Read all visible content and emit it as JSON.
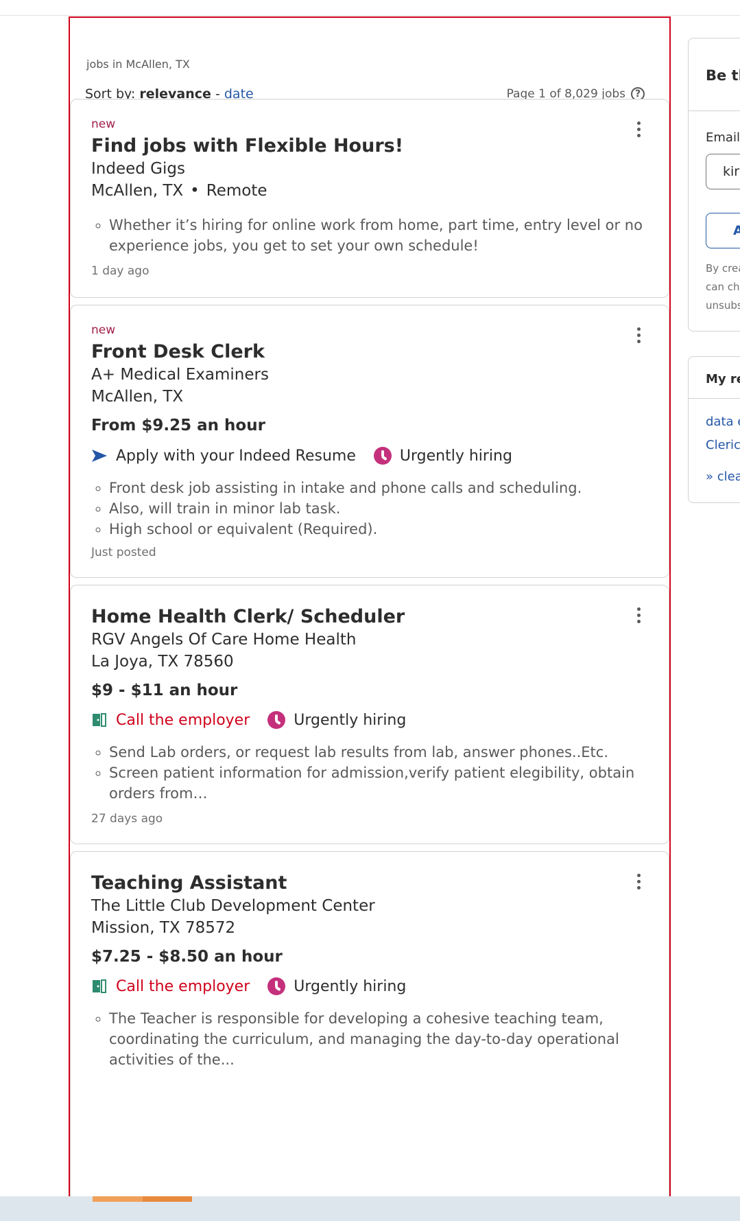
{
  "search": {
    "query_title": "jobs in McAllen, TX"
  },
  "sort": {
    "label": "Sort by:",
    "relevance": "relevance",
    "separator": "-",
    "date": "date"
  },
  "pagination": {
    "info": "Page 1 of 8,029 jobs",
    "help_glyph": "?"
  },
  "jobs": [
    {
      "badge": "new",
      "title": "Find jobs with Flexible Hours!",
      "company": "Indeed Gigs",
      "location": "McAllen, TX",
      "location_extra": "Remote",
      "bullets": [
        "Whether it’s hiring for online work from home, part time, entry level or no experience jobs, you get to set your own schedule!"
      ],
      "posted": "1 day ago"
    },
    {
      "badge": "new",
      "title": "Front Desk Clerk",
      "company": "A+ Medical Examiners",
      "location": "McAllen, TX",
      "salary": "From $9.25 an hour",
      "apply": "Apply with your Indeed Resume",
      "urgent": "Urgently hiring",
      "bullets": [
        "Front desk job assisting in intake and phone calls and scheduling.",
        "Also, will train in minor lab task.",
        "High school or equivalent (Required)."
      ],
      "posted": "Just posted"
    },
    {
      "title": "Home Health Clerk/ Scheduler",
      "company": "RGV Angels Of Care Home Health",
      "location": "La Joya, TX 78560",
      "salary": "$9 - $11 an hour",
      "call": "Call the employer",
      "urgent": "Urgently hiring",
      "bullets": [
        "Send Lab orders, or request lab results from lab, answer phones..Etc.",
        "Screen patient information for admission,verify patient elegibility, obtain orders from…"
      ],
      "posted": "27 days ago"
    },
    {
      "title": "Teaching Assistant",
      "company": "The Little Club Development Center",
      "location": "Mission, TX 78572",
      "salary": "$7.25 - $8.50 an hour",
      "call": "Call the employer",
      "urgent": "Urgently hiring",
      "bullets": [
        "The Teacher is responsible for developing a cohesive teaching team, coordinating the curriculum, and managing the day-to-day operational activities of the..."
      ]
    }
  ],
  "side_alert": {
    "heading": "Be th",
    "email_label": "Email",
    "email_value": "kirl",
    "button_label": "A",
    "fine_print": [
      "By crea",
      "can ch",
      "unsubs"
    ]
  },
  "side_recent": {
    "heading": "My rec",
    "links": [
      "data e",
      "Clerica",
      "» clear"
    ]
  },
  "colors": {
    "accent": "#2557a7",
    "badge": "#a1214a",
    "urgent": "#c4307b",
    "call": "#d0021b",
    "outline": "#d0021b"
  }
}
